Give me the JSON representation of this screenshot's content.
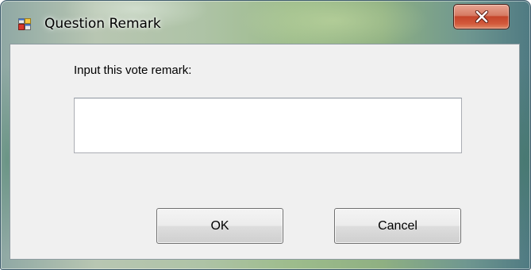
{
  "window": {
    "title": "Question Remark",
    "title_icon": "app-window-icon",
    "close_icon": "close-icon"
  },
  "form": {
    "prompt_label": "Input this vote remark:",
    "remark_value": "",
    "remark_placeholder": ""
  },
  "buttons": {
    "ok_label": "OK",
    "cancel_label": "Cancel"
  },
  "colors": {
    "client_background": "#f0f0f0",
    "close_button": "#c4442a"
  }
}
